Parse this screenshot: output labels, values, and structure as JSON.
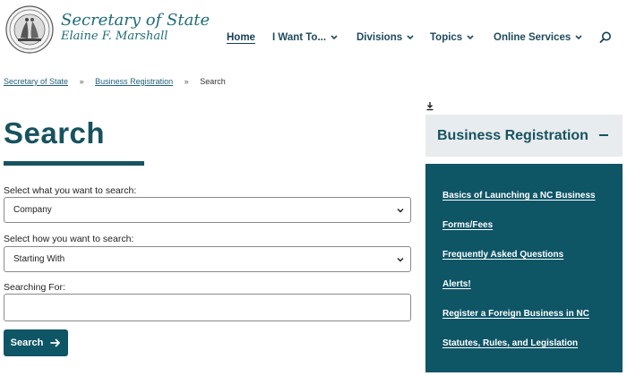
{
  "header": {
    "title": "Secretary of State",
    "subtitle": "Elaine F. Marshall",
    "nav": [
      {
        "label": "Home"
      },
      {
        "label": "I Want To..."
      },
      {
        "label": "Divisions"
      },
      {
        "label": "Topics"
      },
      {
        "label": "Online Services"
      }
    ]
  },
  "breadcrumb": {
    "items": [
      "Secretary of State",
      "Business Registration",
      "Search"
    ],
    "separator": "»"
  },
  "main": {
    "title": "Search",
    "fields": [
      {
        "label": "Select what you want to search:",
        "value": "Company"
      },
      {
        "label": "Select how you want to search:",
        "value": "Starting With"
      },
      {
        "label": "Searching For:",
        "value": ""
      }
    ],
    "search_button": "Search"
  },
  "sidebar": {
    "title": "Business Registration",
    "links": [
      "Basics of Launching a NC Business",
      "Forms/Fees",
      "Frequently Asked Questions",
      "Alerts!",
      "Register a Foreign Business in NC",
      "Statutes, Rules, and Legislation"
    ]
  },
  "icons": {
    "seal": "state-seal-icon",
    "search": "search-icon",
    "chevron": "chevron-down-icon",
    "download": "download-icon",
    "collapse": "minus-icon",
    "arrow": "arrow-right-icon"
  },
  "colors": {
    "brand_teal": "#17535f",
    "panel_teal": "#0e5566",
    "panel_header_bg": "#e8ecef"
  }
}
